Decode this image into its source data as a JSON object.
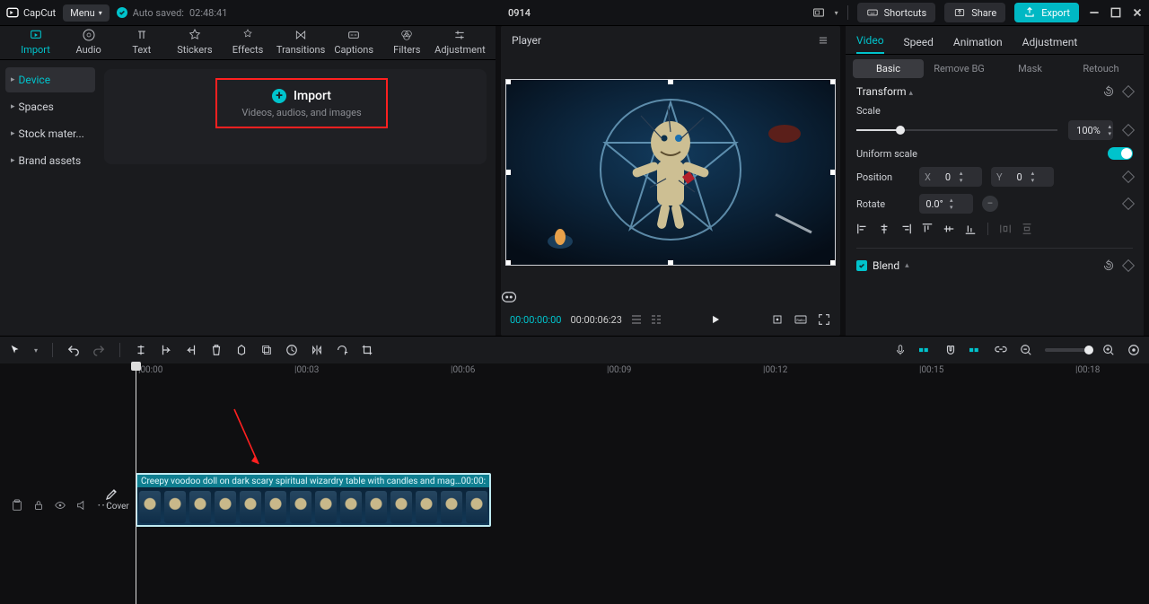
{
  "app": {
    "name": "CapCut"
  },
  "menu": {
    "label": "Menu"
  },
  "autosave": {
    "label": "Auto saved:",
    "time": "02:48:41"
  },
  "project": {
    "title": "0914"
  },
  "titlebar": {
    "shortcuts": "Shortcuts",
    "share": "Share",
    "export": "Export"
  },
  "mediaTabs": {
    "import": "Import",
    "audio": "Audio",
    "text": "Text",
    "stickers": "Stickers",
    "effects": "Effects",
    "transitions": "Transitions",
    "captions": "Captions",
    "filters": "Filters",
    "adjustment": "Adjustment"
  },
  "leftNav": {
    "device": "Device",
    "spaces": "Spaces",
    "stock": "Stock mater...",
    "brand": "Brand assets"
  },
  "importCard": {
    "title": "Import",
    "subtitle": "Videos, audios, and images"
  },
  "player": {
    "title": "Player",
    "current": "00:00:00:00",
    "total": "00:00:06:23"
  },
  "inspector": {
    "tabs": {
      "video": "Video",
      "speed": "Speed",
      "animation": "Animation",
      "adjustment": "Adjustment"
    },
    "subtabs": {
      "basic": "Basic",
      "removebg": "Remove BG",
      "mask": "Mask",
      "retouch": "Retouch"
    },
    "transform": {
      "label": "Transform",
      "scale_label": "Scale",
      "scale_value": "100%",
      "uniform_label": "Uniform scale",
      "position_label": "Position",
      "x_label": "X",
      "x_value": "0",
      "y_label": "Y",
      "y_value": "0",
      "rotate_label": "Rotate",
      "rotate_value": "0.0°"
    },
    "blend": {
      "label": "Blend"
    }
  },
  "ruler": {
    "marks": [
      "|00:00",
      "|00:03",
      "|00:06",
      "|00:09",
      "|00:12",
      "|00:15",
      "|00:18"
    ]
  },
  "clip": {
    "title": "Creepy voodoo doll on dark scary spiritual wizardry table with candles and magic",
    "dur": "00:00:"
  },
  "cover": {
    "label": "Cover"
  }
}
